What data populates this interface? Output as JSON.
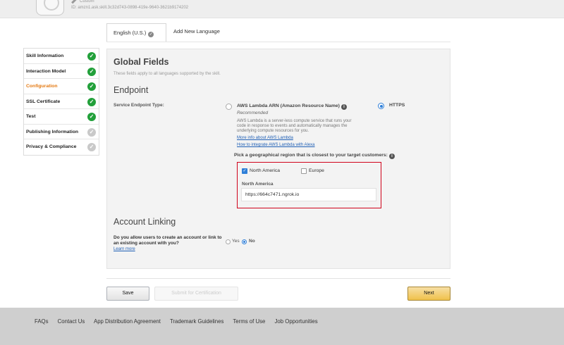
{
  "header": {
    "skill_type": "Custom",
    "skill_id": "ID:  amzn1.ask.skill.3c32d743-0898-419e-9640-3621b9174202"
  },
  "language_tabs": {
    "active": "English (U.S.)",
    "add": "Add New Language"
  },
  "sidebar": {
    "items": [
      {
        "label": "Skill Information",
        "status": "complete"
      },
      {
        "label": "Interaction Model",
        "status": "complete"
      },
      {
        "label": "Configuration",
        "status": "complete",
        "active": true
      },
      {
        "label": "SSL Certificate",
        "status": "complete"
      },
      {
        "label": "Test",
        "status": "complete"
      },
      {
        "label": "Publishing Information",
        "status": "incomplete"
      },
      {
        "label": "Privacy & Compliance",
        "status": "incomplete"
      }
    ]
  },
  "global_fields": {
    "title": "Global Fields",
    "subtitle": "These fields apply to all languages supported by the skill."
  },
  "endpoint": {
    "title": "Endpoint",
    "service_type_label": "Service Endpoint Type:",
    "lambda": {
      "label": "AWS Lambda ARN (Amazon Resource Name)",
      "recommended": "Recommended",
      "description": "AWS Lambda is a server-less compute service that runs your code in response to events and automatically manages the underlying compute resources for you.",
      "link_more": "More info about AWS Lambda",
      "link_integrate": "How to integrate AWS Lambda with Alexa"
    },
    "https_label": "HTTPS",
    "selected": "HTTPS",
    "region_question": "Pick a geographical region that is closest to your target customers:",
    "regions": {
      "north_america": {
        "label": "North America",
        "checked": true
      },
      "europe": {
        "label": "Europe",
        "checked": false
      }
    },
    "north_america_heading": "North America",
    "north_america_url": "https://664c7471.ngrok.io"
  },
  "account_linking": {
    "title": "Account Linking",
    "question": "Do you allow users to create an account or link to an existing account with you?",
    "learn_more": "Learn more",
    "yes": "Yes",
    "no": "No",
    "selected": "No"
  },
  "actions": {
    "save": "Save",
    "submit": "Submit for Certification",
    "next": "Next"
  },
  "footer": {
    "links": [
      "FAQs",
      "Contact Us",
      "App Distribution Agreement",
      "Trademark Guidelines",
      "Terms of Use",
      "Job Opportunities"
    ]
  },
  "colors": {
    "accent_orange": "#e47911",
    "complete_green": "#22a03a",
    "highlight_red": "#d0021b",
    "link_blue": "#1f5fb5",
    "next_button": "#f0c14b"
  }
}
